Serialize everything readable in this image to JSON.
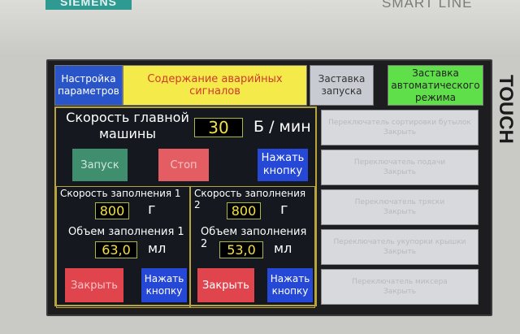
{
  "device": {
    "brand": "SIEMENS",
    "model": "SMART LINE",
    "side_label": "TOUCH"
  },
  "tabs": [
    {
      "label": "Настройка параметров"
    },
    {
      "label": "Содержание аварийных сигналов"
    },
    {
      "label": "Заставка запуска"
    },
    {
      "label": "Заставка автоматического режима"
    }
  ],
  "main": {
    "speed_label": "Скорость главной машины",
    "speed_value": "30",
    "speed_unit": "Б / мин",
    "start_label": "Запуск",
    "stop_label": "Стоп",
    "press_label": "Нажать кнопку"
  },
  "fill1": {
    "speed_label": "Скорость заполнения 1",
    "speed_value": "800",
    "speed_unit": "г",
    "volume_label": "Объем заполнения 1",
    "volume_value": "63,0",
    "volume_unit": "мл",
    "close_label": "Закрыть",
    "press_label": "Нажать кнопку"
  },
  "fill2": {
    "speed_label": "Скорость заполнения 2",
    "speed_value": "800",
    "speed_unit": "г",
    "volume_label": "Объем заполнения 2",
    "volume_value": "53,0",
    "volume_unit": "мл",
    "close_label": "Закрыть",
    "press_label": "Нажать кнопку"
  },
  "switches": [
    {
      "title": "Переключатель сортировки бутылок",
      "state": "Закрыть"
    },
    {
      "title": "Переключатель подачи",
      "state": "Закрыть"
    },
    {
      "title": "Переключатель тряски",
      "state": "Закрыть"
    },
    {
      "title": "Переключатель укупорки крышки",
      "state": "Закрыть"
    },
    {
      "title": "Переключатель миксера",
      "state": "Закрыть"
    }
  ],
  "colors": {
    "tab_blue": "#2a55c8",
    "tab_yellow": "#f4ea4a",
    "tab_green": "#5fe04a",
    "start_green": "#3f8e6e",
    "stop_red": "#e35d63",
    "close_red": "#e0454e",
    "button_blue": "#2648d6",
    "value_yellow": "#f3e04a"
  }
}
